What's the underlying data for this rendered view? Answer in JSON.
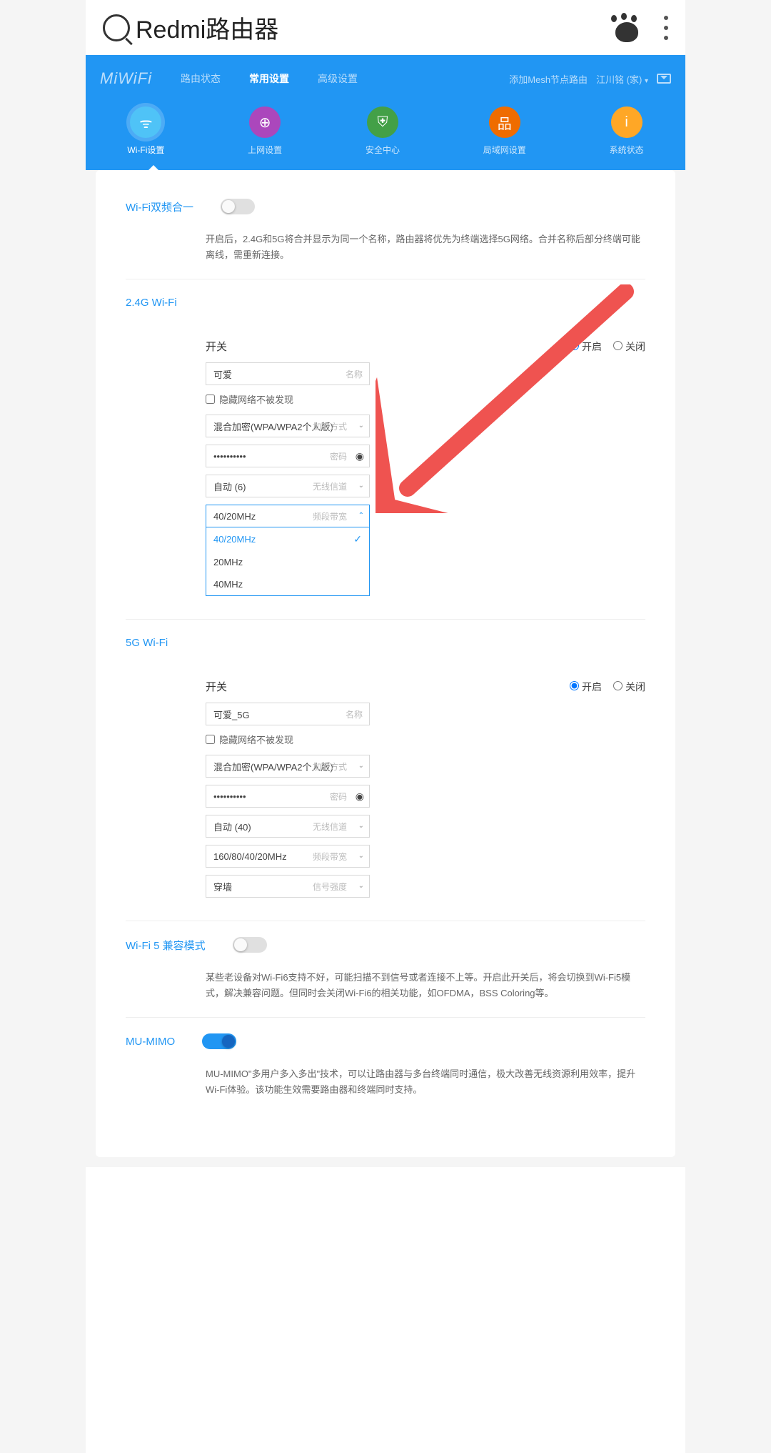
{
  "top": {
    "brand": "Redmi路由器"
  },
  "header": {
    "logo": "MiWiFi",
    "tabs": [
      "路由状态",
      "常用设置",
      "高级设置"
    ],
    "right": {
      "mesh": "添加Mesh节点路由",
      "user": "江川铭 (家)"
    }
  },
  "subnav": [
    {
      "label": "Wi-Fi设置",
      "bg": "#4fc3f7",
      "glyph": "ᯤ"
    },
    {
      "label": "上网设置",
      "bg": "#ab47bc",
      "glyph": "⊕"
    },
    {
      "label": "安全中心",
      "bg": "#43a047",
      "glyph": "⛨"
    },
    {
      "label": "局域网设置",
      "bg": "#ef6c00",
      "glyph": "品"
    },
    {
      "label": "系统状态",
      "bg": "#ffa726",
      "glyph": "i"
    }
  ],
  "dualband": {
    "title": "Wi-Fi双频合一",
    "desc": "开启后，2.4G和5G将合并显示为同一个名称，路由器将优先为终端选择5G网络。合并名称后部分终端可能离线，需重新连接。"
  },
  "wifi24": {
    "title": "2.4G Wi-Fi",
    "switchLabel": "开关",
    "on": "开启",
    "off": "关闭",
    "name": "可爱",
    "nameHint": "名称",
    "hide": "隐藏网络不被发现",
    "enc": "混合加密(WPA/WPA2个人版)",
    "encHint": "加密方式",
    "pwd": "••••••••••",
    "pwdHint": "密码",
    "chan": "自动 (6)",
    "chanHint": "无线信道",
    "bw": "40/20MHz",
    "bwHint": "频段带宽",
    "bwOpts": [
      "40/20MHz",
      "20MHz",
      "40MHz"
    ]
  },
  "wifi5g": {
    "title": "5G Wi-Fi",
    "switchLabel": "开关",
    "on": "开启",
    "off": "关闭",
    "name": "可爱_5G",
    "nameHint": "名称",
    "hide": "隐藏网络不被发现",
    "enc": "混合加密(WPA/WPA2个人版)",
    "encHint": "加密方式",
    "pwd": "••••••••••",
    "pwdHint": "密码",
    "chan": "自动 (40)",
    "chanHint": "无线信道",
    "bw": "160/80/40/20MHz",
    "bwHint": "频段带宽",
    "sig": "穿墙",
    "sigHint": "信号强度"
  },
  "compat": {
    "title": "Wi-Fi 5 兼容模式",
    "desc": "某些老设备对Wi-Fi6支持不好，可能扫描不到信号或者连接不上等。开启此开关后，将会切换到Wi-Fi5模式，解决兼容问题。但同时会关闭Wi-Fi6的相关功能，如OFDMA，BSS Coloring等。"
  },
  "mumimo": {
    "title": "MU-MIMO",
    "desc": "MU-MIMO\"多用户多入多出\"技术，可以让路由器与多台终端同时通信，极大改善无线资源利用效率，提升Wi-Fi体验。该功能生效需要路由器和终端同时支持。"
  }
}
